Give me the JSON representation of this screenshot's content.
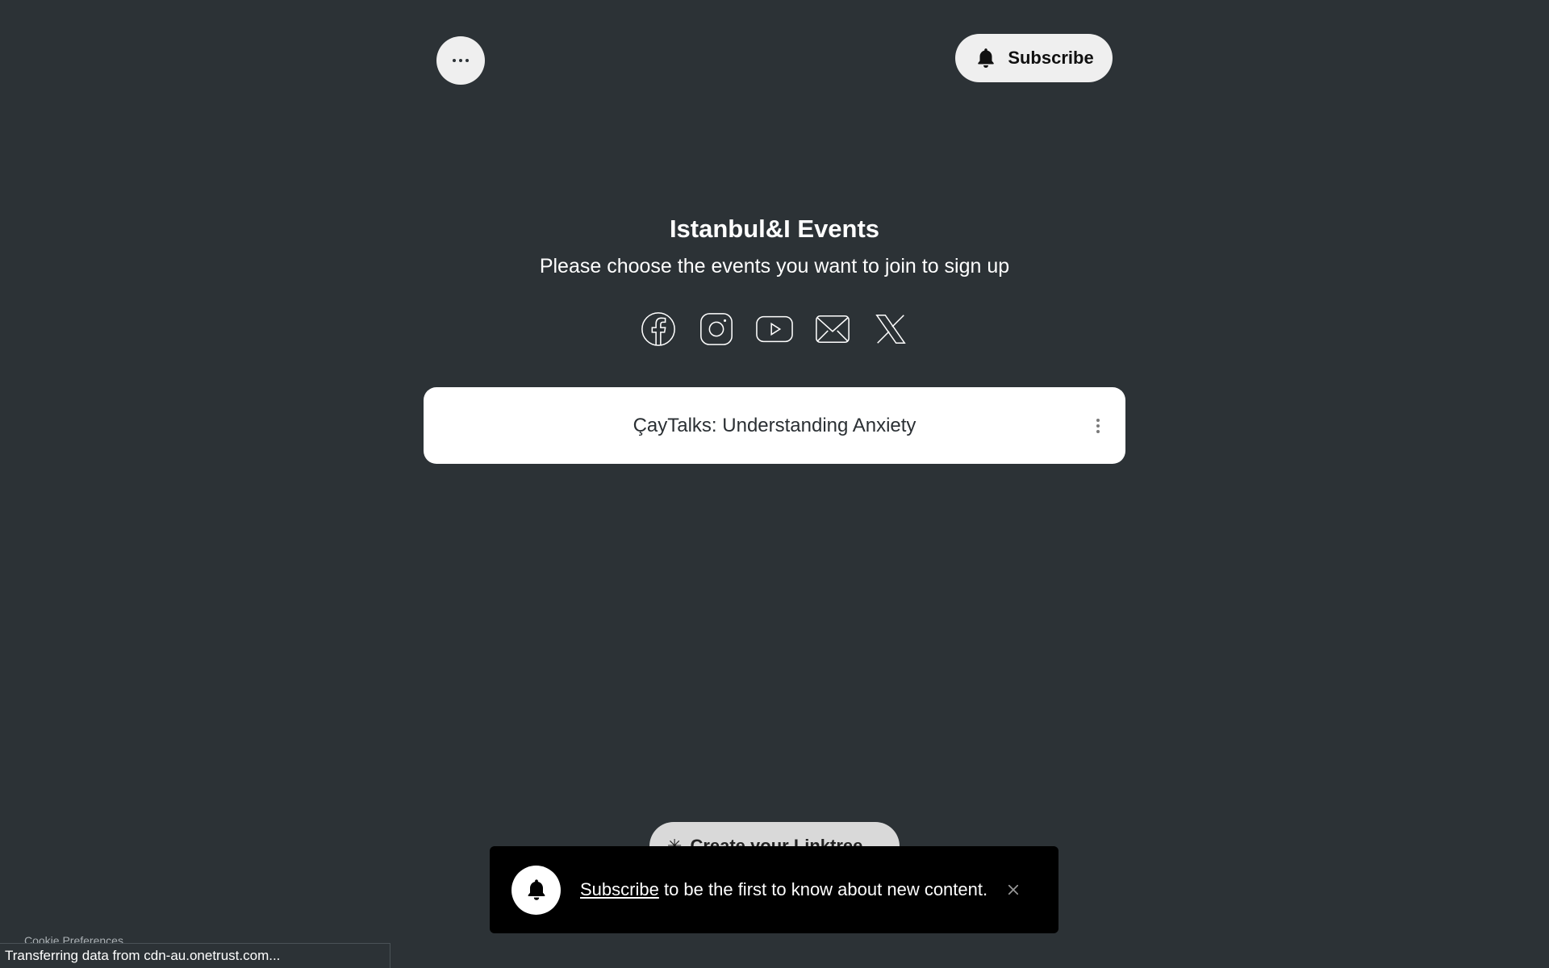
{
  "header": {
    "menu_icon": "ellipsis-icon",
    "subscribe_label": "Subscribe",
    "subscribe_icon": "bell-icon"
  },
  "profile": {
    "title": "Istanbul&I Events",
    "subtitle": "Please choose the events you want to join to sign up"
  },
  "socials": [
    {
      "name": "facebook-icon"
    },
    {
      "name": "instagram-icon"
    },
    {
      "name": "youtube-icon"
    },
    {
      "name": "email-icon"
    },
    {
      "name": "x-icon"
    }
  ],
  "links": [
    {
      "label": "ÇayTalks: Understanding Anxiety",
      "menu_icon": "kebab-menu-icon"
    }
  ],
  "behind_button": {
    "label": "Create your Linktree"
  },
  "toast": {
    "link_text": "Subscribe",
    "message": " to be the first to know about new content.",
    "close_icon": "close-icon"
  },
  "footer": {
    "cookie_label": "Cookie Preferences"
  },
  "status_bar": {
    "text": "Transferring data from cdn-au.onetrust.com..."
  },
  "colors": {
    "background": "#2c3236",
    "card": "#ffffff",
    "button": "#efefef",
    "toast": "#000000"
  }
}
